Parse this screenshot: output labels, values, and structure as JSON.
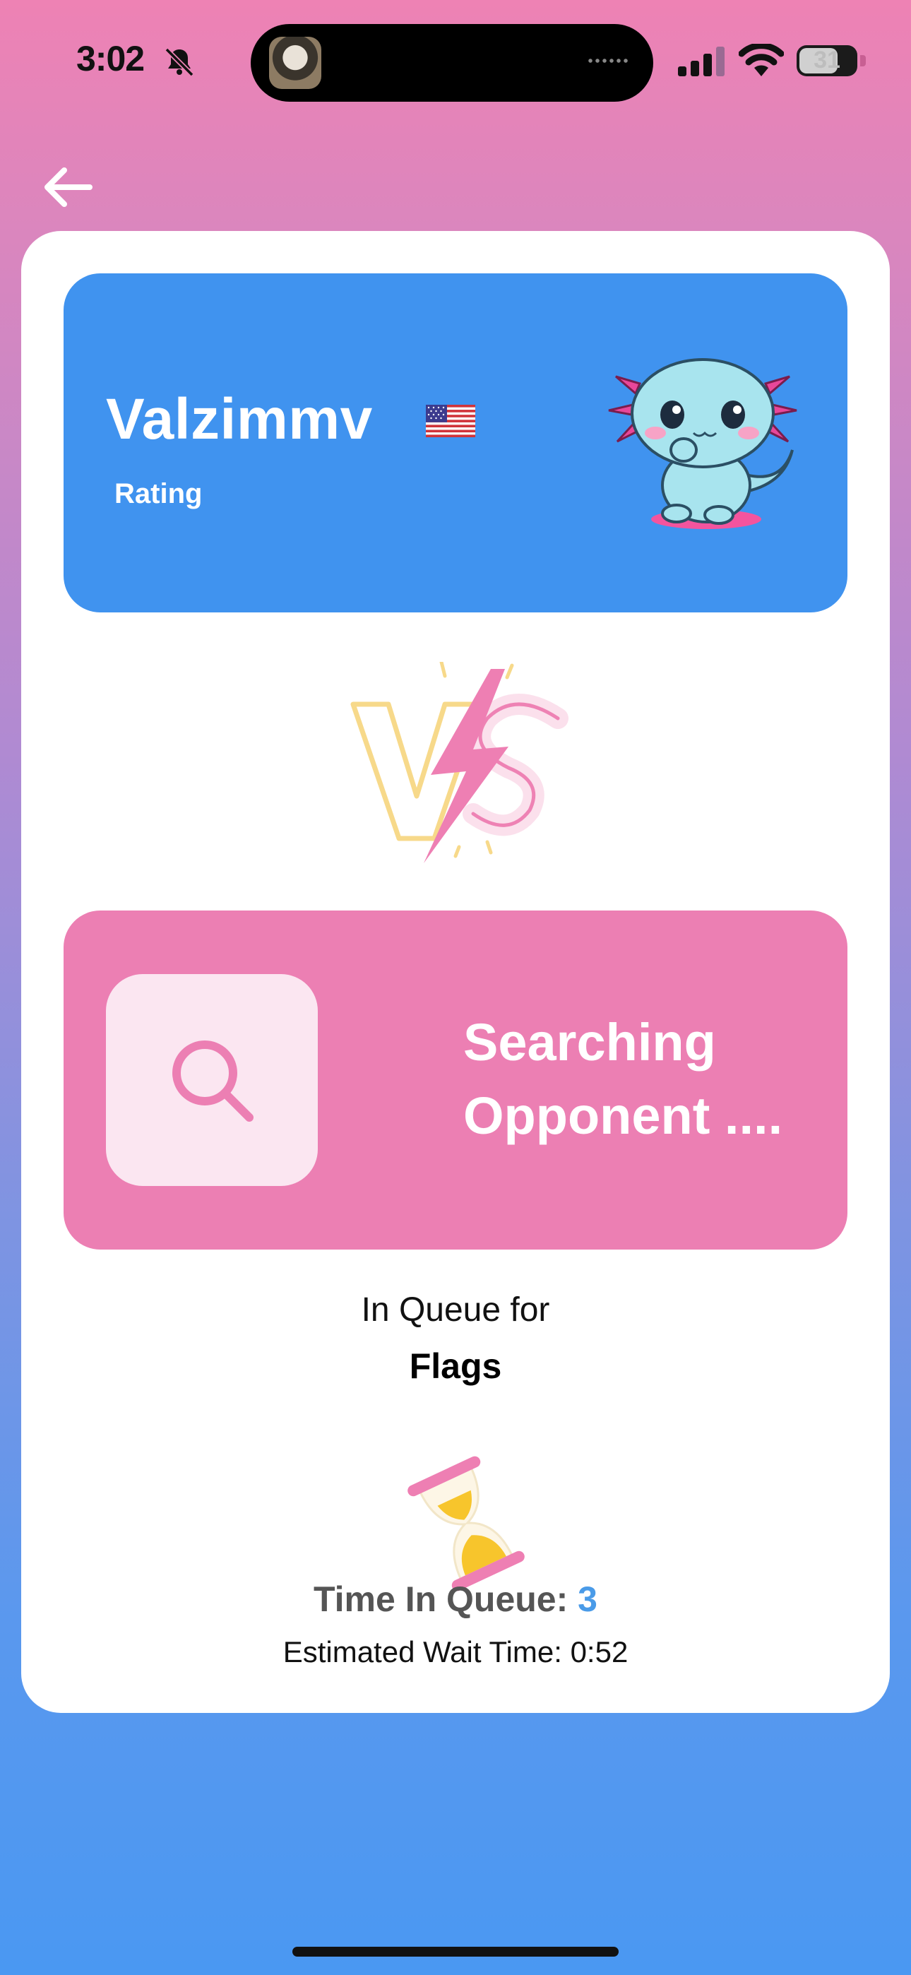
{
  "status_bar": {
    "time": "3:02",
    "battery": "31"
  },
  "nav": {
    "back_icon": "arrow-left-icon"
  },
  "player": {
    "name": "Valzimmv",
    "rating_label": "Rating",
    "flag": "us-flag-icon",
    "avatar": "axolotl-mascot"
  },
  "versus": {
    "icon": "vs-lightning-icon"
  },
  "opponent": {
    "status_line1": "Searching",
    "status_line2": "Opponent ....",
    "icon": "search-icon"
  },
  "queue": {
    "label": "In Queue for",
    "game": "Flags",
    "time_label": "Time In Queue:",
    "time_value": "3",
    "wait_label": "Estimated Wait Time: 0:52",
    "icon": "hourglass-icon"
  },
  "colors": {
    "player_card": "#4093EF",
    "search_card": "#EC7FB3",
    "search_tile": "#FBE6F1",
    "time_value": "#4A9BE8"
  }
}
